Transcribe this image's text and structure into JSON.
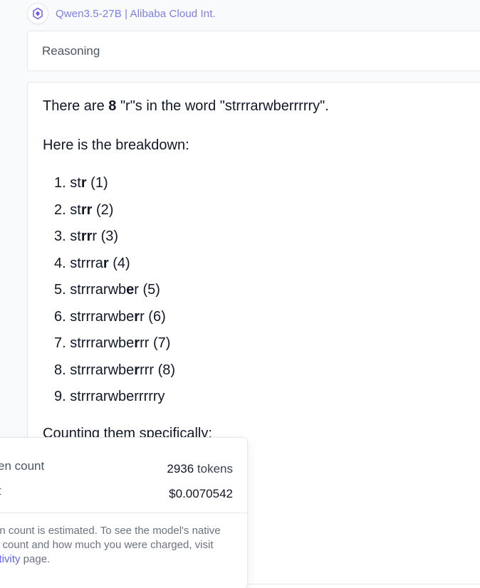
{
  "header": {
    "model_name": "Qwen3.5-27B | Alibaba Cloud Int.",
    "logo_icon": "qwen-logo-icon"
  },
  "reasoning": {
    "label": "Reasoning"
  },
  "answer": {
    "intro_prefix": "There are ",
    "intro_count": "8",
    "intro_suffix": " \"r\"s in the word \"strrrarwberrrrry\".",
    "breakdown_heading": "Here is the breakdown:",
    "items": [
      {
        "num": "1.",
        "pre": "st",
        "bold": "r",
        "post": "",
        "count": " (1)"
      },
      {
        "num": "2.",
        "pre": "st",
        "bold": "rr",
        "post": "",
        "count": " (2)"
      },
      {
        "num": "3.",
        "pre": "st",
        "bold": "rr",
        "post": "r",
        "count": " (3)"
      },
      {
        "num": "4.",
        "pre": "strrra",
        "bold": "r",
        "post": "",
        "count": " (4)"
      },
      {
        "num": "5.",
        "pre": "strrrarwb",
        "bold": "e",
        "post": "r",
        "count": " (5)"
      },
      {
        "num": "6.",
        "pre": "strrrarwbe",
        "bold": "r",
        "post": "r",
        "count": " (6)"
      },
      {
        "num": "7.",
        "pre": "strrrarwbe",
        "bold": "r",
        "post": "rr",
        "count": " (7)"
      },
      {
        "num": "8.",
        "pre": "strrrarwbe",
        "bold": "r",
        "post": "rrr",
        "count": " (8)"
      },
      {
        "num": "9.",
        "pre": "strrrarwberrrrry",
        "bold": "",
        "post": "",
        "count": ""
      }
    ],
    "counting_line": "Counting them specifically:"
  },
  "popover": {
    "token_label": "en count",
    "token_value_number": "2936",
    "token_value_unit": " tokens",
    "cost_label": "t",
    "cost_value": "$0.0070542",
    "note_line1": "en count is estimated. To see the model's native",
    "note_line2": "n count and how much you were charged, visit",
    "note_link": "ctivity",
    "note_end": " page."
  }
}
